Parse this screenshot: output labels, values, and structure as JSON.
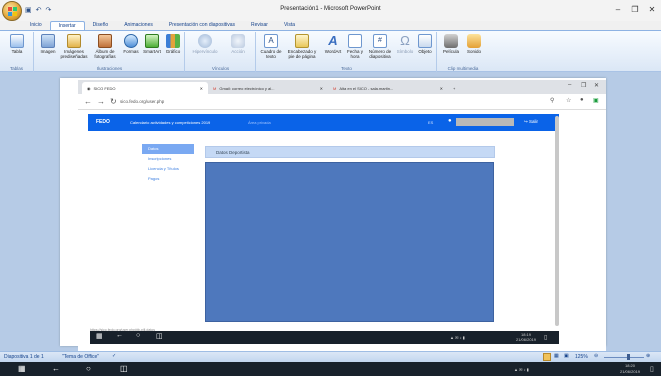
{
  "window": {
    "title": "Presentación1 - Microsoft PowerPoint"
  },
  "ribbon": {
    "tabs": [
      "Inicio",
      "Insertar",
      "Diseño",
      "Animaciones",
      "Presentación con diapositivas",
      "Revisar",
      "Vista"
    ],
    "active_tab": "Insertar",
    "buttons": {
      "tabla": "Tabla",
      "imagen": "Imagen",
      "imagenes": "Imágenes prediseñadas",
      "album": "Álbum de fotografías",
      "formas": "Formas",
      "smartart": "SmartArt",
      "grafico": "Gráfico",
      "hipervinculo": "Hipervínculo",
      "accion": "Acción",
      "cuadro": "Cuadro de texto",
      "encabezado": "Encabezado y pie de página",
      "wordart": "WordArt",
      "fecha": "Fecha y hora",
      "numero": "Número de diapositiva",
      "simbolo": "Símbolo",
      "objeto": "Objeto",
      "pelicula": "Película",
      "sonido": "Sonido"
    },
    "groups": {
      "tablas": "Tablas",
      "ilustraciones": "Ilustraciones",
      "vinculos": "Vínculos",
      "texto": "Texto",
      "clip": "Clip multimedia"
    }
  },
  "browser": {
    "tabs": [
      {
        "label": "SICO FEDO"
      },
      {
        "label": "Gmail: correo electrónico y al..."
      },
      {
        "label": "Alta en el SICO - sala.martin..."
      }
    ],
    "url": "sico.fedo.org/user.php",
    "status_url": "https://sico.fedo.org/user.php#tb-pill-datos"
  },
  "site": {
    "logo": "FEDO",
    "header_text": "Calendario actividades y competiciones 2019",
    "header_link": "Área privada",
    "lang": "ES",
    "logout": "Salir",
    "menu": [
      "Datos",
      "Inscripciones",
      "Licencia y Títulos",
      "Pagos"
    ],
    "active_menu": "Datos",
    "panel_title": "Datos Deportista"
  },
  "inner_taskbar": {
    "time": "18:19",
    "date": "21/06/2019"
  },
  "status": {
    "slide": "Diapositiva 1 de 1",
    "theme": "\"Tema de Office\"",
    "zoom": "125%"
  },
  "taskbar": {
    "time": "18:20",
    "date": "21/06/2019"
  },
  "colors": {
    "site_header": "#0a63e8",
    "panel_fill": "#4e78bd",
    "ribbon": "#dbe7f6"
  }
}
